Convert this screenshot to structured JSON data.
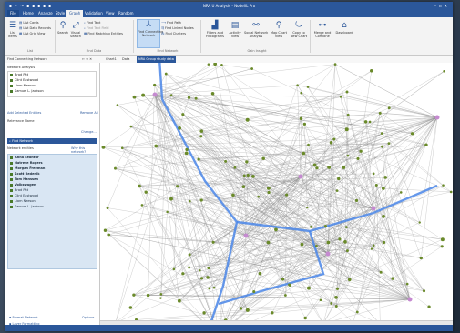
{
  "window": {
    "title": "NRA U Analysis - NodeXL Pro",
    "qat": "▪ ↶ ↷ ▪ ▪ ▪ ▪ ▪"
  },
  "tabs": [
    "File",
    "Home",
    "Analyze",
    "Style",
    "Graph",
    "Validation",
    "View",
    "Random"
  ],
  "ribbon": {
    "list": {
      "label": "List",
      "items": [
        "List Cards",
        "List Data Records",
        "List Grid View"
      ],
      "big": "List\nItems"
    },
    "find": {
      "search": "Search",
      "visual": "Visual\nSearch",
      "small": [
        "Find Text",
        "Find Text Field",
        "Find Matching Entities"
      ],
      "group": "Find Data"
    },
    "network": {
      "find_connecting": "Find Connecting\nNetwork",
      "small": [
        "Find Path",
        "Find Linked Nodes",
        "Find Clusters"
      ],
      "group": "Find Network"
    },
    "insights": {
      "items": [
        "Filters and\nHistograms",
        "Activity\nView",
        "Social Network\nAnalysis",
        "Map Chart\nView",
        "Copy to\nNew Chart",
        "Merge and\nCombine",
        "Dashboard"
      ],
      "group": "Gain Insight"
    }
  },
  "toolbar2": {
    "selector": "Find Connecting Network",
    "buttons": [
      "Chart1",
      "Data"
    ],
    "active_chart": "NRA Group study data"
  },
  "left": {
    "network_analysis_label": "Network Analysis",
    "analysis_items": [
      "Brad Pitt",
      "Clint Eastwood",
      "Liam Neeson",
      "Samuel L. Jackson"
    ],
    "add_selected": "Add Selected Entities",
    "remove_all": "Remove All",
    "network_name_label": "Relevance Name",
    "network_name_link": "Change...",
    "find_network_btn": "Find Network",
    "network_entities_label": "Network entities",
    "why_link": "Why this network?",
    "network_entities": [
      {
        "name": "Anna Leontur",
        "bold": true
      },
      {
        "name": "Natrese Rogers",
        "bold": true
      },
      {
        "name": "Morgan Freeman",
        "bold": true
      },
      {
        "name": "Scott Redenik",
        "bold": true
      },
      {
        "name": "Tom Hanssen",
        "bold": true
      },
      {
        "name": "Volkswagen",
        "bold": true
      },
      {
        "name": "Brad Pitt",
        "bold": false
      },
      {
        "name": "Clint Eastwood",
        "bold": false
      },
      {
        "name": "Liam Neeson",
        "bold": false
      },
      {
        "name": "Samuel L. Jackson",
        "bold": false
      }
    ],
    "format_network": "Format Network",
    "options_link": "Options...",
    "layer_formatting": "Layer Formatting"
  },
  "colors": {
    "accent": "#2b579a",
    "highlight_path": "#4a86e8",
    "link_gray": "#8a8a8a",
    "node_green": "#6a8a2a"
  },
  "icons": {
    "list": "list-icon",
    "search": "search-icon",
    "network": "network-icon",
    "filter": "filter-icon",
    "map": "map-pin-icon",
    "dashboard": "dashboard-icon"
  }
}
